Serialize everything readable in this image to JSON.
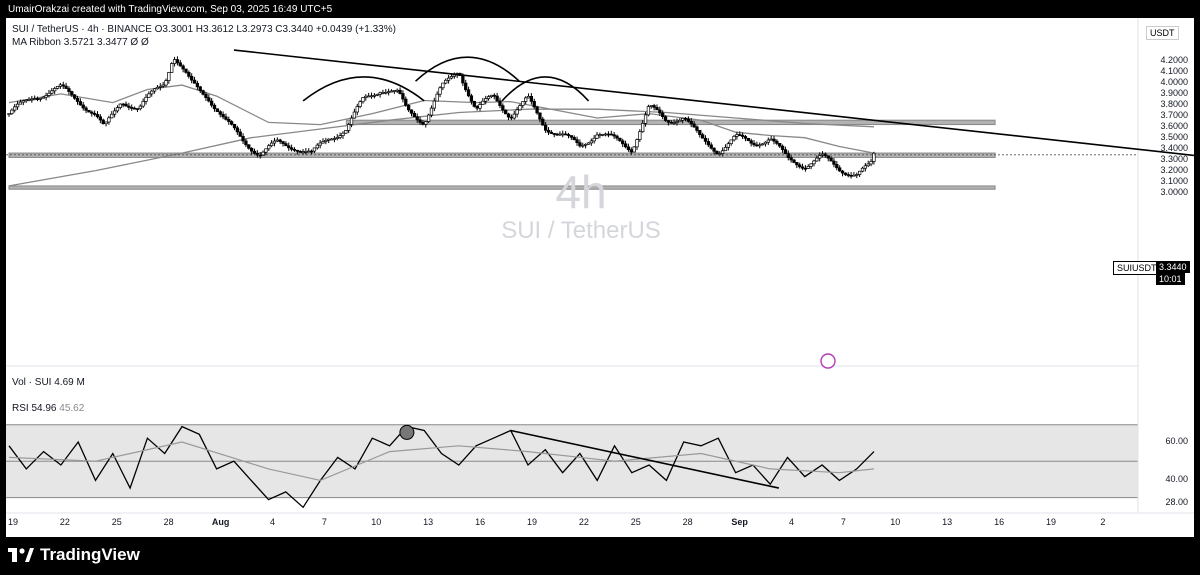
{
  "header": {
    "credit": "UmairOrakzai created with TradingView.com, Sep 03, 2025 16:49 UTC+5"
  },
  "legend": {
    "symbol_line": "SUI / TetherUS · 4h · BINANCE  O3.3001  H3.3612  L3.2973  C3.3440  +0.0439 (+1.33%)",
    "ma_line": "MA Ribbon  3.5721  3.3477  Ø  Ø",
    "vol_line": "Vol · SUI  4.69 M",
    "rsi_label": "RSI",
    "rsi_value": "54.96",
    "rsi_ma_value": "45.62"
  },
  "watermark": {
    "interval": "4h",
    "pair": "SUI / TetherUS"
  },
  "price_axis": {
    "currency": "USDT",
    "ticks": [
      "4.2000",
      "4.1000",
      "4.0000",
      "3.9000",
      "3.8000",
      "3.7000",
      "3.6000",
      "3.5000",
      "3.4000",
      "3.3000",
      "3.2000",
      "3.1000",
      "3.0000"
    ],
    "last_label": "SUIUSDT",
    "last_price": "3.3440",
    "countdown": "10:01"
  },
  "rsi_axis": {
    "ticks": [
      "60.00",
      "40.00",
      "28.00"
    ]
  },
  "time_axis": {
    "ticks": [
      "19",
      "22",
      "25",
      "28",
      "Aug",
      "4",
      "7",
      "10",
      "13",
      "16",
      "19",
      "22",
      "25",
      "28",
      "Sep",
      "4",
      "7",
      "10",
      "13",
      "16",
      "19",
      "2"
    ]
  },
  "branding": {
    "name": "TradingView"
  },
  "colors": {
    "up": "#ffffff",
    "down": "#000000",
    "candle_border": "#000000",
    "ma_line": "#888888",
    "zone": "#b2b2b2",
    "rsi_band": "#e6e6e6",
    "trendline": "#000000"
  },
  "chart_data": {
    "type": "candlestick",
    "title": "SUI / TetherUS · 4h · BINANCE",
    "ylim": [
      2.95,
      4.3
    ],
    "x_range_days": [
      "Jul 19",
      "Oct 2"
    ],
    "last": {
      "open": 3.3001,
      "high": 3.3612,
      "low": 3.2973,
      "close": 3.344,
      "change": 0.0439,
      "change_pct": 1.33
    },
    "price_path": [
      [
        0,
        3.72
      ],
      [
        1.5,
        3.88
      ],
      [
        3,
        3.95
      ],
      [
        4,
        3.85
      ],
      [
        5,
        3.7
      ],
      [
        5.5,
        3.58
      ],
      [
        6.5,
        3.85
      ],
      [
        7.5,
        3.75
      ],
      [
        8.5,
        3.95
      ],
      [
        9,
        4.02
      ],
      [
        9.5,
        4.25
      ],
      [
        10,
        4.12
      ],
      [
        10.5,
        4.0
      ],
      [
        11.5,
        3.88
      ],
      [
        12.5,
        3.65
      ],
      [
        13.5,
        3.48
      ],
      [
        14.5,
        3.35
      ],
      [
        15.5,
        3.45
      ],
      [
        16.5,
        3.42
      ],
      [
        17.5,
        3.35
      ],
      [
        18.5,
        3.5
      ],
      [
        19.5,
        3.58
      ],
      [
        20.5,
        3.85
      ],
      [
        21.5,
        3.95
      ],
      [
        22.5,
        3.9
      ],
      [
        23,
        3.75
      ],
      [
        24,
        3.65
      ],
      [
        25,
        3.95
      ],
      [
        26,
        4.12
      ],
      [
        27,
        3.75
      ],
      [
        28,
        3.88
      ],
      [
        29,
        3.7
      ],
      [
        30,
        3.85
      ],
      [
        31,
        3.6
      ],
      [
        32,
        3.52
      ],
      [
        33,
        3.42
      ],
      [
        34,
        3.55
      ],
      [
        35,
        3.48
      ],
      [
        36,
        3.4
      ],
      [
        37,
        3.78
      ],
      [
        38,
        3.65
      ],
      [
        39,
        3.7
      ],
      [
        40,
        3.48
      ],
      [
        41,
        3.38
      ],
      [
        42,
        3.5
      ],
      [
        43,
        3.45
      ],
      [
        44,
        3.5
      ],
      [
        45,
        3.3
      ],
      [
        46,
        3.25
      ],
      [
        47,
        3.32
      ],
      [
        48,
        3.22
      ],
      [
        49,
        3.16
      ],
      [
        49.8,
        3.24
      ],
      [
        50,
        3.344
      ]
    ],
    "moving_averages": [
      {
        "name": "MA Ribbon",
        "value": 3.5721,
        "path": [
          [
            0,
            3.82
          ],
          [
            3,
            3.9
          ],
          [
            6,
            3.82
          ],
          [
            8,
            3.94
          ],
          [
            10,
            3.98
          ],
          [
            12,
            3.88
          ],
          [
            15,
            3.64
          ],
          [
            18,
            3.62
          ],
          [
            21,
            3.72
          ],
          [
            24,
            3.84
          ],
          [
            27,
            3.82
          ],
          [
            29,
            3.83
          ],
          [
            31,
            3.77
          ],
          [
            34,
            3.68
          ],
          [
            37,
            3.72
          ],
          [
            40,
            3.66
          ],
          [
            42,
            3.55
          ],
          [
            44,
            3.52
          ],
          [
            46,
            3.5
          ],
          [
            48,
            3.42
          ],
          [
            50,
            3.36
          ]
        ]
      },
      {
        "name": "MA Ribbon",
        "value": 3.3477,
        "path": [
          [
            0,
            3.06
          ],
          [
            5,
            3.2
          ],
          [
            10,
            3.36
          ],
          [
            14,
            3.5
          ],
          [
            18,
            3.58
          ],
          [
            22,
            3.66
          ],
          [
            26,
            3.73
          ],
          [
            30,
            3.76
          ],
          [
            34,
            3.76
          ],
          [
            38,
            3.73
          ],
          [
            42,
            3.68
          ],
          [
            46,
            3.63
          ],
          [
            50,
            3.6
          ]
        ]
      }
    ],
    "zones": [
      {
        "low": 3.62,
        "high": 3.66,
        "from_day": 19.5,
        "to_day": 57
      },
      {
        "low": 3.32,
        "high": 3.36,
        "from_day": 0,
        "to_day": 57
      },
      {
        "low": 3.03,
        "high": 3.06,
        "from_day": 0,
        "to_day": 57
      }
    ],
    "trendline": {
      "from": [
        13,
        4.3
      ],
      "to": [
        69,
        3.33
      ]
    },
    "rsi": {
      "value": 54.96,
      "ma": 45.62,
      "ylim": [
        25,
        70
      ],
      "band": [
        31,
        69
      ],
      "path": [
        [
          0,
          58
        ],
        [
          1,
          46
        ],
        [
          2,
          55
        ],
        [
          3,
          48
        ],
        [
          4,
          60
        ],
        [
          5,
          40
        ],
        [
          6,
          54
        ],
        [
          7,
          36
        ],
        [
          8,
          62
        ],
        [
          9,
          54
        ],
        [
          10,
          68
        ],
        [
          11,
          64
        ],
        [
          12,
          46
        ],
        [
          13,
          50
        ],
        [
          14,
          40
        ],
        [
          15,
          30
        ],
        [
          16,
          34
        ],
        [
          17,
          26
        ],
        [
          18,
          40
        ],
        [
          19,
          52
        ],
        [
          20,
          46
        ],
        [
          21,
          62
        ],
        [
          22,
          58
        ],
        [
          23,
          68
        ],
        [
          24,
          66
        ],
        [
          25,
          54
        ],
        [
          26,
          48
        ],
        [
          27,
          58
        ],
        [
          28,
          62
        ],
        [
          29,
          66
        ],
        [
          30,
          48
        ],
        [
          31,
          56
        ],
        [
          32,
          44
        ],
        [
          33,
          54
        ],
        [
          34,
          40
        ],
        [
          35,
          58
        ],
        [
          36,
          44
        ],
        [
          37,
          48
        ],
        [
          38,
          40
        ],
        [
          39,
          60
        ],
        [
          40,
          58
        ],
        [
          41,
          62
        ],
        [
          42,
          44
        ],
        [
          43,
          48
        ],
        [
          44,
          38
        ],
        [
          45,
          52
        ],
        [
          46,
          42
        ],
        [
          47,
          48
        ],
        [
          48,
          40
        ],
        [
          49,
          46
        ],
        [
          50,
          55
        ]
      ],
      "ma_path": [
        [
          0,
          52
        ],
        [
          5,
          50
        ],
        [
          10,
          60
        ],
        [
          15,
          46
        ],
        [
          18,
          40
        ],
        [
          22,
          55
        ],
        [
          26,
          58
        ],
        [
          30,
          55
        ],
        [
          35,
          50
        ],
        [
          40,
          54
        ],
        [
          44,
          46
        ],
        [
          48,
          44
        ],
        [
          50,
          46
        ]
      ],
      "trendline": {
        "from": [
          29,
          66
        ],
        "to": [
          44.5,
          36
        ]
      }
    }
  }
}
